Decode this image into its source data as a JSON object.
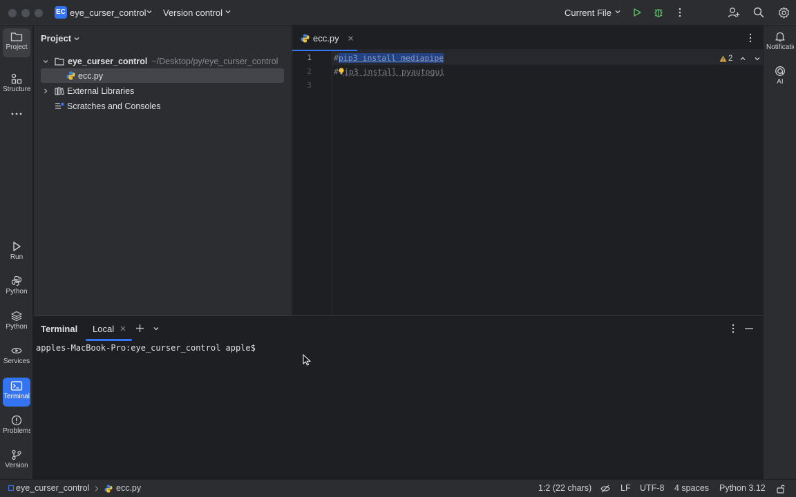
{
  "titlebar": {
    "project_badge": "EC",
    "project_name": "eye_curser_control",
    "vcs_label": "Version control",
    "run_config": "Current File"
  },
  "leftbar": {
    "items": [
      {
        "label": "Project",
        "icon": "folder-icon"
      },
      {
        "label": "Structure",
        "icon": "structure-icon"
      },
      {
        "label": "Run",
        "icon": "run-icon"
      },
      {
        "label": "Python",
        "icon": "python-console-icon"
      },
      {
        "label": "Python",
        "icon": "python-packages-icon"
      },
      {
        "label": "Services",
        "icon": "services-icon"
      },
      {
        "label": "Terminal",
        "icon": "terminal-icon"
      },
      {
        "label": "Problems",
        "icon": "problems-icon"
      },
      {
        "label": "Version",
        "icon": "git-icon"
      }
    ]
  },
  "rightbar": {
    "notifications_label": "Notifications",
    "ai_label": "AI"
  },
  "project_panel": {
    "title": "Project",
    "root_name": "eye_curser_control",
    "root_path": "~/Desktop/py/eye_curser_control",
    "file_name": "ecc.py",
    "external_libs": "External Libraries",
    "scratches": "Scratches and Consoles"
  },
  "editor": {
    "tab_name": "ecc.py",
    "warning_count": "2",
    "line_numbers": [
      "1",
      "2",
      "3"
    ],
    "line1_hash": "#",
    "line1_code": "pip3 install mediapipe",
    "line2_hash": "#",
    "line2_code": "ip3 install pyautogui"
  },
  "terminal": {
    "title": "Terminal",
    "tab": "Local",
    "prompt": "apples-MacBook-Pro:eye_curser_control apple$"
  },
  "statusbar": {
    "breadcrumb_project": "eye_curser_control",
    "breadcrumb_file": "ecc.py",
    "position": "1:2 (22 chars)",
    "line_sep": "LF",
    "encoding": "UTF-8",
    "indent": "4 spaces",
    "interpreter": "Python 3.12"
  },
  "colors": {
    "accent": "#3574f0",
    "run_green": "#5fb865",
    "warning": "#e2a93b"
  }
}
